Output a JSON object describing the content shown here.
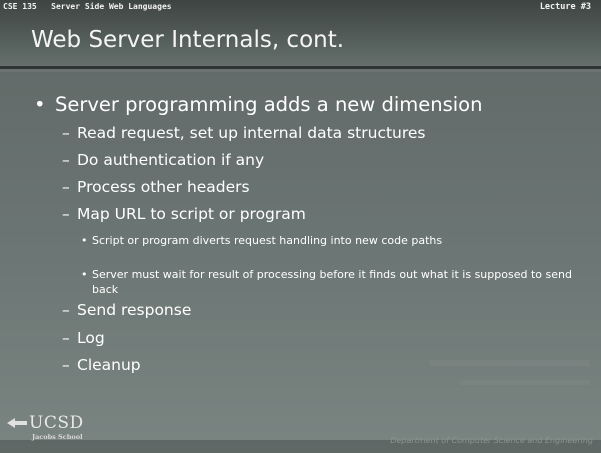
{
  "header": {
    "course": "CSE 135   Server Side Web Languages",
    "lecture": "Lecture #3",
    "title": "Web Server Internals, cont."
  },
  "content": {
    "bullet_glyph": "•",
    "dash_glyph": "–",
    "main_bullet": "Server programming adds a new dimension",
    "items": [
      "Read request, set up internal data structures",
      "Do authentication if any",
      "Process other headers",
      "Map URL to script or program"
    ],
    "subitems": [
      "Script or program diverts request handling into new code paths",
      "Server must wait for result of processing before it finds out what it is supposed to send back"
    ],
    "items_after": [
      "Send response",
      "Log",
      "Cleanup"
    ]
  },
  "footer": {
    "logo_text": "UCSD",
    "logo_subtext": "Jacobs School",
    "department": "Department of Computer Science and Engineering"
  },
  "colors": {
    "background": "#6a7472",
    "header": "#4a5250",
    "text": "#ffffff"
  }
}
